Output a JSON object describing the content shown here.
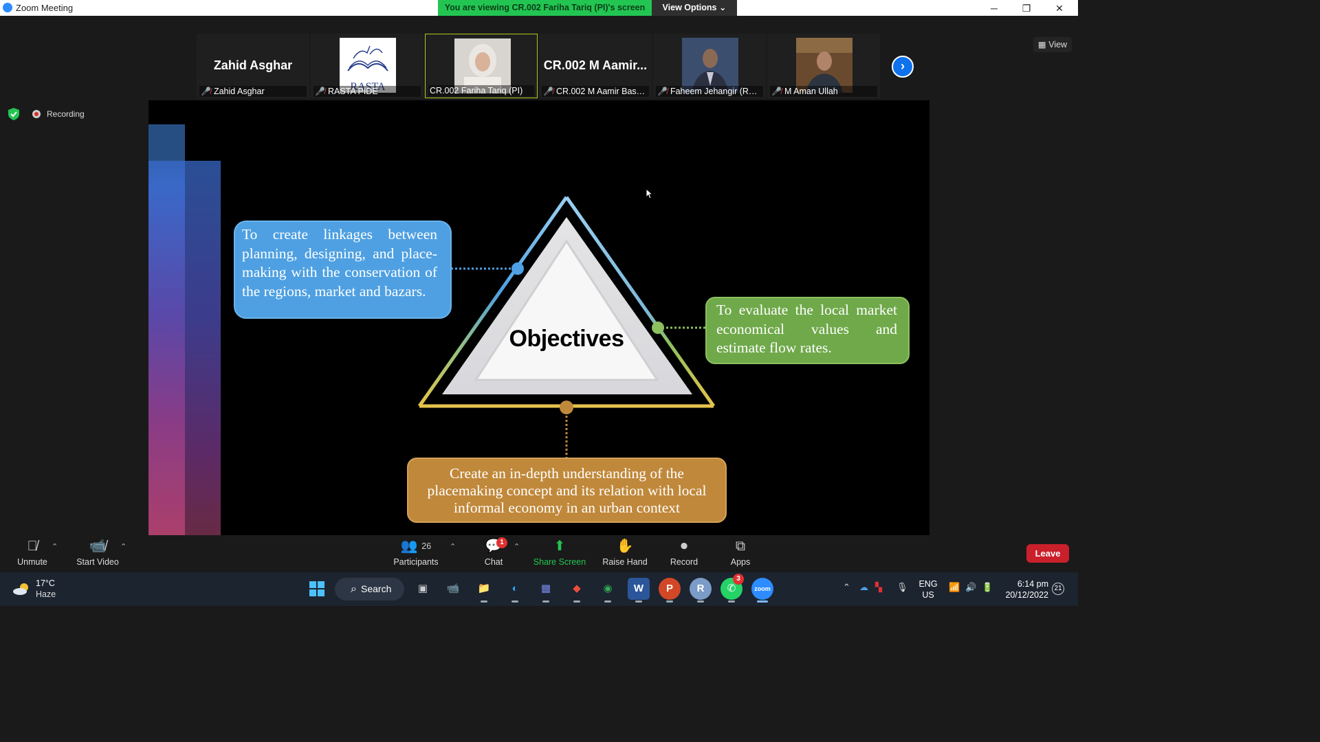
{
  "window": {
    "title": "Zoom Meeting",
    "viewing_banner": "You are viewing CR.002 Fariha Tariq (PI)'s screen",
    "view_options": "View Options"
  },
  "thumbnails": [
    {
      "big_name": "Zahid Asghar",
      "label": "Zahid Asghar",
      "type": "name"
    },
    {
      "big_name": "",
      "label": "RASTA PIDE",
      "type": "logo",
      "logo_text": "RASTA"
    },
    {
      "big_name": "",
      "label": "CR.002 Fariha Tariq (PI)",
      "type": "photo",
      "active": true
    },
    {
      "big_name": "CR.002  M  Aamir...",
      "label": "CR.002 M Aamir Bashe...",
      "type": "name"
    },
    {
      "big_name": "",
      "label": "Faheem Jehangir (RAS...",
      "type": "photo"
    },
    {
      "big_name": "",
      "label": "M Aman Ullah",
      "type": "photo"
    }
  ],
  "view_button": "View",
  "recording_label": "Recording",
  "slide": {
    "center_label": "Objectives",
    "objective_blue": "To create linkages between planning, designing, and place-making with the conservation of the regions, market and bazars.",
    "objective_green": "To evaluate the local market economical values and estimate flow rates.",
    "objective_gold": "Create an in-depth understanding of the placemaking concept and its relation with local informal economy in an urban context"
  },
  "toolbar": {
    "unmute": "Unmute",
    "start_video": "Start Video",
    "participants": "Participants",
    "participants_count": "26",
    "chat": "Chat",
    "chat_badge": "1",
    "share_screen": "Share Screen",
    "raise_hand": "Raise Hand",
    "record": "Record",
    "apps": "Apps",
    "leave": "Leave"
  },
  "taskbar": {
    "temperature": "17°C",
    "weather": "Haze",
    "search": "Search",
    "whatsapp_badge": "3",
    "lang_line1": "ENG",
    "lang_line2": "US",
    "time": "6:14 pm",
    "date": "20/12/2022",
    "notifications": "21"
  },
  "colors": {
    "zoom_blue": "#0e72ed",
    "banner_green": "#23c552",
    "leave_red": "#c9202b",
    "box_blue": "#4ea0e2",
    "box_green": "#6fa94a",
    "box_gold": "#c0883a"
  }
}
